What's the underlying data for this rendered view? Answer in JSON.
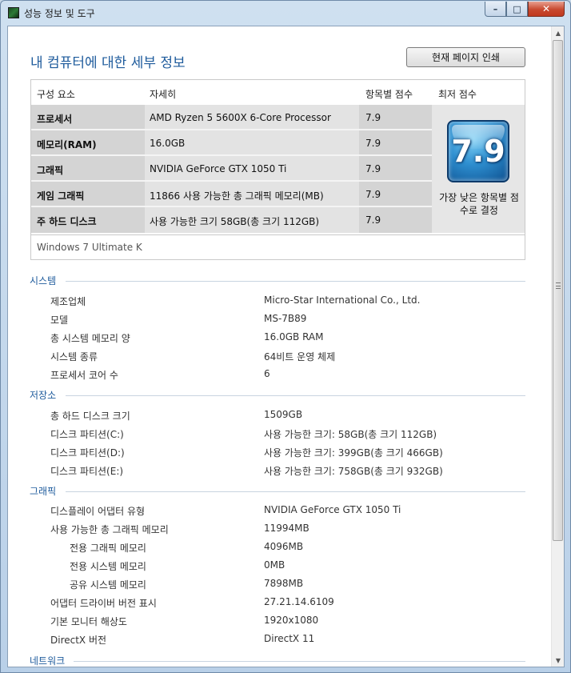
{
  "window": {
    "title": "성능 정보 및 도구"
  },
  "caption": {
    "minimize": "–",
    "maximize": "□",
    "close": "✕"
  },
  "header": {
    "title": "내 컴퓨터에 대한 세부 정보",
    "print_button": "현재 페이지 인쇄"
  },
  "score_table": {
    "headers": {
      "component": "구성 요소",
      "details": "자세히",
      "subscore": "항목별 점수",
      "base": "최저 점수"
    },
    "rows": [
      {
        "component": "프로세서",
        "details": "AMD Ryzen 5 5600X 6-Core Processor",
        "score": "7.9"
      },
      {
        "component": "메모리(RAM)",
        "details": "16.0GB",
        "score": "7.9"
      },
      {
        "component": "그래픽",
        "details": "NVIDIA GeForce GTX 1050 Ti",
        "score": "7.9"
      },
      {
        "component": "게임 그래픽",
        "details": "11866 사용 가능한 총 그래픽 메모리(MB)",
        "score": "7.9"
      },
      {
        "component": "주 하드 디스크",
        "details": "사용 가능한 크기 58GB(총 크기 112GB)",
        "score": "7.9"
      }
    ],
    "base_score": "7.9",
    "base_note": "가장 낮은 항목별 점수로 결정",
    "footer": "Windows 7 Ultimate K"
  },
  "system": {
    "heading": "시스템",
    "items": [
      {
        "label": "제조업체",
        "value": "Micro-Star International Co., Ltd."
      },
      {
        "label": "모델",
        "value": "MS-7B89"
      },
      {
        "label": "총 시스템 메모리 양",
        "value": "16.0GB RAM"
      },
      {
        "label": "시스템 종류",
        "value": "64비트 운영 체제"
      },
      {
        "label": "프로세서 코어 수",
        "value": "6"
      }
    ]
  },
  "storage": {
    "heading": "저장소",
    "items": [
      {
        "label": "총 하드 디스크 크기",
        "value": "1509GB"
      },
      {
        "label": "디스크 파티션(C:)",
        "value": "사용 가능한 크기: 58GB(총 크기 112GB)"
      },
      {
        "label": "디스크 파티션(D:)",
        "value": "사용 가능한 크기: 399GB(총 크기 466GB)"
      },
      {
        "label": "디스크 파티션(E:)",
        "value": "사용 가능한 크기: 758GB(총 크기 932GB)"
      }
    ]
  },
  "graphics": {
    "heading": "그래픽",
    "items": [
      {
        "label": "디스플레이 어댑터 유형",
        "value": "NVIDIA GeForce GTX 1050 Ti"
      },
      {
        "label": "사용 가능한 총 그래픽 메모리",
        "value": "11994MB"
      },
      {
        "label": "전용 그래픽 메모리",
        "value": "4096MB"
      },
      {
        "label": "전용 시스템 메모리",
        "value": "0MB"
      },
      {
        "label": "공유 시스템 메모리",
        "value": "7898MB"
      },
      {
        "label": "어댑터 드라이버 버전 표시",
        "value": "27.21.14.6109"
      },
      {
        "label": "기본 모니터 해상도",
        "value": "1920x1080"
      },
      {
        "label": "DirectX 버전",
        "value": "DirectX 11"
      }
    ]
  },
  "network": {
    "heading": "네트워크"
  }
}
